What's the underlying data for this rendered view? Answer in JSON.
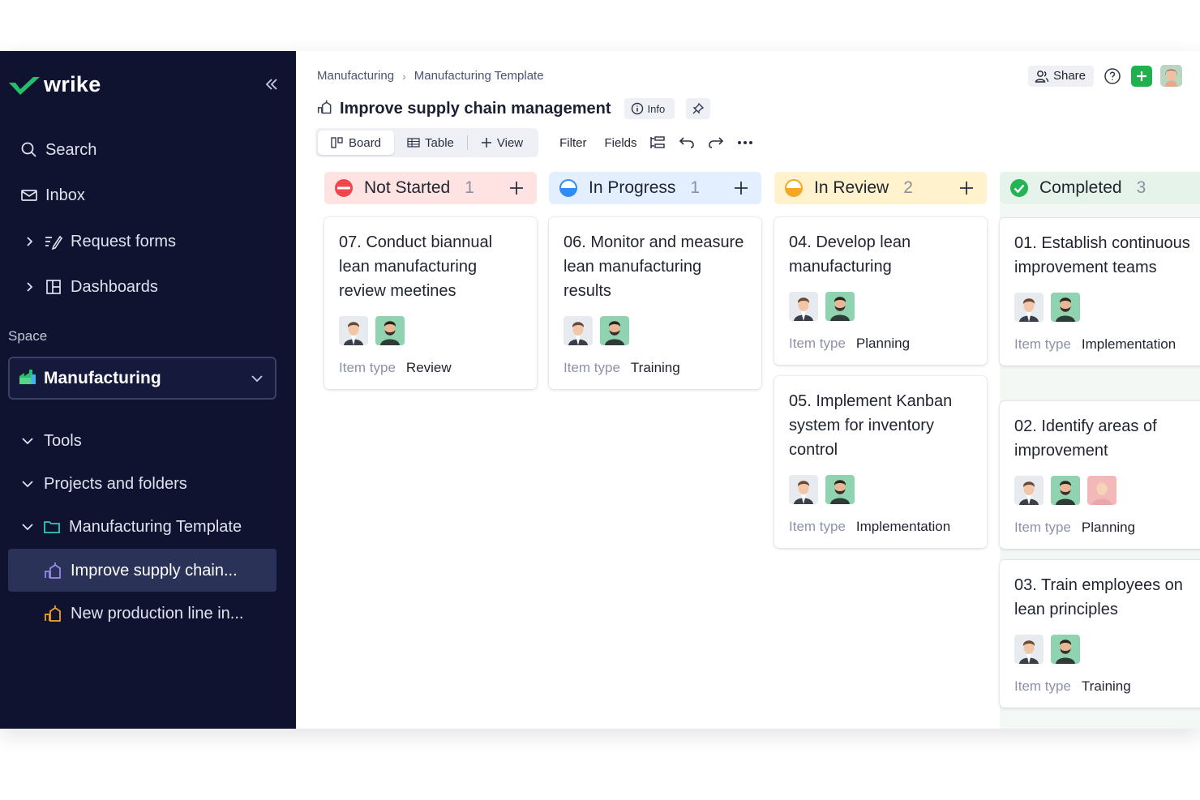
{
  "brand": {
    "name": "wrike",
    "accent": "#23c16b"
  },
  "sidebar": {
    "search": "Search",
    "inbox": "Inbox",
    "request_forms": "Request forms",
    "dashboards": "Dashboards",
    "space_label": "Space",
    "space_name": "Manufacturing",
    "tools": "Tools",
    "projects_and_folders": "Projects and folders",
    "folder": "Manufacturing Template",
    "items": [
      {
        "label": "Improve supply chain...",
        "icon": "project-icon-purple",
        "active": true
      },
      {
        "label": "New production line in...",
        "icon": "project-icon-orange",
        "active": false
      }
    ]
  },
  "breadcrumb": {
    "parent": "Manufacturing",
    "current": "Manufacturing Template"
  },
  "header": {
    "title": "Improve supply chain management",
    "info": "Info",
    "share": "Share"
  },
  "toolbar": {
    "board": "Board",
    "table": "Table",
    "view": "View",
    "filter": "Filter",
    "fields": "Fields"
  },
  "board": {
    "item_type_label": "Item type",
    "columns": [
      {
        "name": "Not Started",
        "count": "1",
        "color": "#ffe3e3",
        "status_color": "#f0474f",
        "cards": [
          {
            "title": "07. Conduct biannual lean manufacturing review meetines",
            "type": "Review",
            "avatars": [
              "man",
              "beard"
            ]
          }
        ]
      },
      {
        "name": "In Progress",
        "count": "1",
        "color": "#e3efff",
        "status_color": "#2f8cf4",
        "cards": [
          {
            "title": "06. Monitor and measure lean manufacturing results",
            "type": "Training",
            "avatars": [
              "man",
              "beard"
            ]
          }
        ]
      },
      {
        "name": "In Review",
        "count": "2",
        "color": "#fff2cc",
        "status_color": "#f5a623",
        "cards": [
          {
            "title": "04. Develop lean manufacturing",
            "type": "Planning",
            "avatars": [
              "man",
              "beard"
            ]
          },
          {
            "title": "05. Implement Kanban system for inventory control",
            "type": "Implementation",
            "avatars": [
              "man",
              "beard"
            ]
          }
        ]
      },
      {
        "name": "Completed",
        "count": "3",
        "color": "#e6f3ea",
        "status_color": "#22b455",
        "cards": [
          {
            "title": "01. Establish continuous improvement teams",
            "type": "Implementation",
            "avatars": [
              "man",
              "beard"
            ]
          },
          {
            "title": "02. Identify areas of improvement",
            "type": "Planning",
            "avatars": [
              "man",
              "beard",
              "woman"
            ]
          },
          {
            "title": "03. Train employees on lean principles",
            "type": "Training",
            "avatars": [
              "man",
              "beard"
            ]
          }
        ]
      }
    ]
  }
}
